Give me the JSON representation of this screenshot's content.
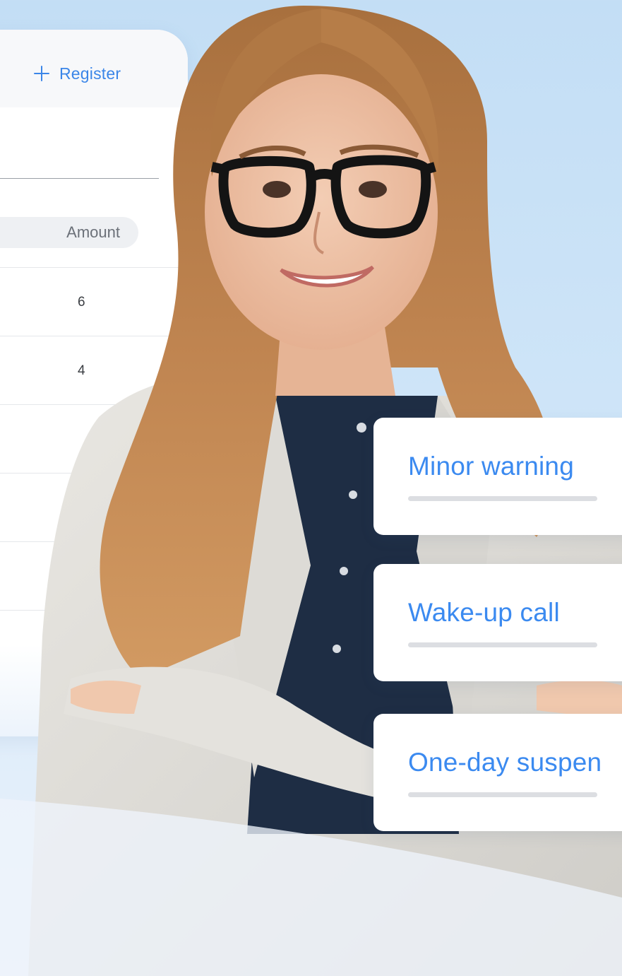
{
  "table": {
    "register_label": "Register",
    "amount_header": "Amount",
    "rows": [
      {
        "amount": "6"
      },
      {
        "amount": "4"
      },
      {
        "amount": ""
      },
      {
        "amount": ""
      },
      {
        "amount": ""
      },
      {
        "amount": ""
      }
    ]
  },
  "options": [
    {
      "label": "Minor warning"
    },
    {
      "label": "Wake-up call"
    },
    {
      "label": "One-day suspen"
    }
  ],
  "colors": {
    "accent": "#3b86e8",
    "background": "#c3def5"
  },
  "icons": {
    "register": "plus-icon"
  }
}
